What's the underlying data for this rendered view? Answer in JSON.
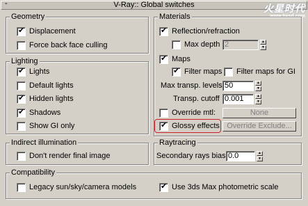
{
  "title_bar": {
    "collapse_symbol": "-",
    "title": "V-Ray:: Global switches"
  },
  "watermark": {
    "main": "火星时代",
    "sub": "www.hxsd.com"
  },
  "geometry": {
    "legend": "Geometry",
    "displacement": {
      "label": "Displacement",
      "checked": true
    },
    "force_back_face_culling": {
      "label": "Force back face culling",
      "checked": false
    }
  },
  "lighting": {
    "legend": "Lighting",
    "lights": {
      "label": "Lights",
      "checked": true
    },
    "default_lights": {
      "label": "Default lights",
      "checked": false
    },
    "hidden_lights": {
      "label": "Hidden lights",
      "checked": true
    },
    "shadows": {
      "label": "Shadows",
      "checked": true
    },
    "show_gi_only": {
      "label": "Show GI only",
      "checked": false
    }
  },
  "indirect_illumination": {
    "legend": "Indirect illumination",
    "dont_render_final_image": {
      "label": "Don't render final image",
      "checked": false
    }
  },
  "materials": {
    "legend": "Materials",
    "reflection_refraction": {
      "label": "Reflection/refraction",
      "checked": true
    },
    "max_depth": {
      "label": "Max depth",
      "checked": false,
      "value": "2"
    },
    "maps": {
      "label": "Maps",
      "checked": true
    },
    "filter_maps": {
      "label": "Filter maps",
      "checked": true
    },
    "filter_maps_for_gi": {
      "label": "Filter maps for GI",
      "checked": false
    },
    "max_transp_levels": {
      "label": "Max transp. levels",
      "value": "50"
    },
    "transp_cutoff": {
      "label": "Transp. cutoff",
      "value": "0.001"
    },
    "override_mtl": {
      "label": "Override mtl:",
      "checked": false,
      "button": "None"
    },
    "glossy_effects": {
      "label": "Glossy effects",
      "checked": true
    },
    "override_exclude_button": "Override Exclude..."
  },
  "raytracing": {
    "legend": "Raytracing",
    "secondary_rays_bias": {
      "label": "Secondary rays bias",
      "value": "0.0"
    }
  },
  "compatibility": {
    "legend": "Compatibility",
    "legacy_sun_sky_camera": {
      "label": "Legacy sun/sky/camera models",
      "checked": false
    },
    "use_3ds_max_photometric_scale": {
      "label": "Use 3ds Max photometric scale",
      "checked": true
    }
  },
  "colors": {
    "panel_bg": "#d4d0c8",
    "highlight_outline": "#d0202a"
  }
}
